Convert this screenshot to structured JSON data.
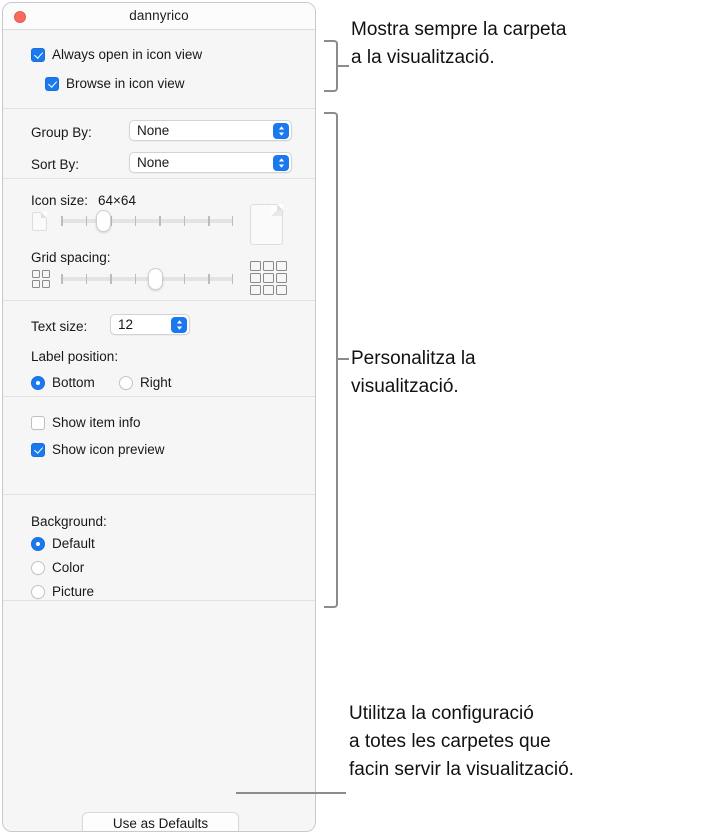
{
  "window": {
    "title": "dannyrico",
    "close_icon": "close-traffic-light-icon"
  },
  "view_options": {
    "always_open": {
      "label": "Always open in icon view",
      "checked": true
    },
    "browse_icon_view": {
      "label": "Browse in icon view",
      "checked": true
    },
    "group_by": {
      "label": "Group By:",
      "value": "None"
    },
    "sort_by": {
      "label": "Sort By:",
      "value": "None"
    },
    "icon_size": {
      "label": "Icon size:",
      "value": "64×64",
      "ticks": 8,
      "thumb_index": 2
    },
    "grid_spacing": {
      "label": "Grid spacing:",
      "ticks": 8,
      "thumb_index": 4
    },
    "text_size": {
      "label": "Text size:",
      "value": "12"
    },
    "label_position": {
      "label": "Label position:",
      "options": [
        {
          "label": "Bottom",
          "selected": true
        },
        {
          "label": "Right",
          "selected": false
        }
      ]
    },
    "show_item_info": {
      "label": "Show item info",
      "checked": false
    },
    "show_icon_preview": {
      "label": "Show icon preview",
      "checked": true
    },
    "background": {
      "label": "Background:",
      "options": [
        {
          "label": "Default",
          "selected": true
        },
        {
          "label": "Color",
          "selected": false
        },
        {
          "label": "Picture",
          "selected": false
        }
      ]
    },
    "use_as_defaults": "Use as Defaults"
  },
  "callouts": {
    "top": "Mostra sempre la carpeta\na la visualització.",
    "middle": "Personalitza la\nvisualització.",
    "bottom": "Utilitza la configuració\na totes les carpetes que\nfacin servir la visualització."
  },
  "colors": {
    "accent": "#1b79f0",
    "close_button": "#fb6a5f",
    "callout_line": "#8c8c8c",
    "window_bg": "#f6f6f6"
  }
}
